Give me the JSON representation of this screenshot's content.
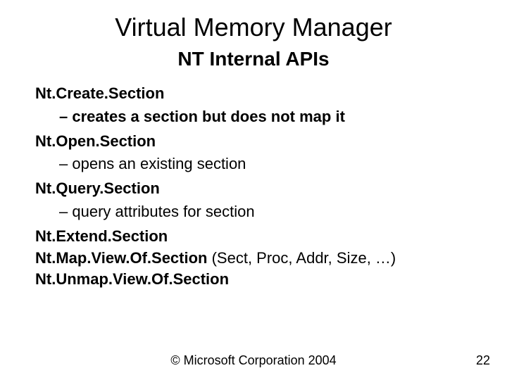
{
  "title": "Virtual Memory Manager",
  "subtitle": "NT Internal APIs",
  "apis": [
    {
      "name": "Nt.Create.Section",
      "detail": "creates a section but does not map it",
      "detail_bold": true
    },
    {
      "name": "Nt.Open.Section",
      "detail": "opens an existing section",
      "detail_bold": false
    },
    {
      "name": "Nt.Query.Section",
      "detail": "query attributes for section",
      "detail_bold": false
    },
    {
      "name": "Nt.Extend.Section",
      "detail": null
    },
    {
      "name": "Nt.Map.View.Of.Section",
      "detail": null,
      "extra": " (Sect, Proc, Addr, Size, …)"
    },
    {
      "name": "Nt.Unmap.View.Of.Section",
      "detail": null
    }
  ],
  "footer": {
    "copyright": "© Microsoft Corporation 2004",
    "page": "22"
  }
}
